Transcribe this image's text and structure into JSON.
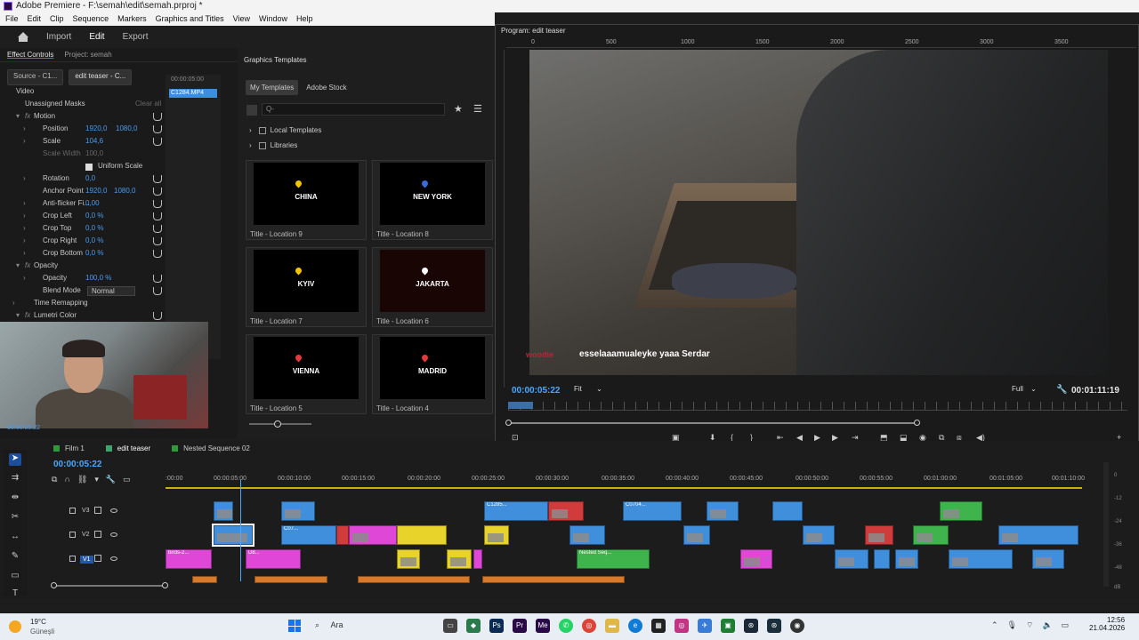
{
  "window": {
    "title": "Adobe Premiere - F:\\semah\\edit\\semah.prproj *"
  },
  "menu": [
    "File",
    "Edit",
    "Clip",
    "Sequence",
    "Markers",
    "Graphics and Titles",
    "View",
    "Window",
    "Help"
  ],
  "app_tabs": {
    "import": "Import",
    "edit": "Edit",
    "export": "Export"
  },
  "effect_controls": {
    "tab_label": "Effect Controls",
    "project_label": "Project: semah",
    "source_label": "Source - C1...",
    "sequence_label": "edit teaser - C...",
    "timecode": "00:00:05:00",
    "clip_name": "C1284.MP4",
    "section": "Video",
    "masks": "Unassigned Masks",
    "clear_all": "Clear all",
    "rows": [
      {
        "name": "Motion",
        "value": ""
      },
      {
        "name": "Position",
        "value": "1920,0",
        "value2": "1080,0"
      },
      {
        "name": "Scale",
        "value": "104,6"
      },
      {
        "name": "Scale Width",
        "value": "100,0"
      },
      {
        "name": "Uniform Scale",
        "value": ""
      },
      {
        "name": "Rotation",
        "value": "0,0"
      },
      {
        "name": "Anchor Point",
        "value": "1920,0",
        "value2": "1080,0"
      },
      {
        "name": "Anti-flicker Fi...",
        "value": "0,00"
      },
      {
        "name": "Crop Left",
        "value": "0,0 %"
      },
      {
        "name": "Crop Top",
        "value": "0,0 %"
      },
      {
        "name": "Crop Right",
        "value": "0,0 %"
      },
      {
        "name": "Crop Bottom",
        "value": "0,0 %"
      },
      {
        "name": "Opacity",
        "value": ""
      },
      {
        "name": "Opacity",
        "value": "100,0 %"
      },
      {
        "name": "Blend Mode",
        "value": "Normal"
      },
      {
        "name": "Time Remapping",
        "value": ""
      },
      {
        "name": "Lumetri Color",
        "value": ""
      }
    ],
    "bottom_timecode": "00:00:05:22"
  },
  "graphics_templates": {
    "title": "Graphics Templates",
    "tabs": [
      "My Templates",
      "Adobe Stock"
    ],
    "search_placeholder": "Q-",
    "folders": [
      "Local Templates",
      "Libraries"
    ],
    "templates": [
      {
        "thumb": "CHINA",
        "caption": "Title - Location 9",
        "pin": "yellow"
      },
      {
        "thumb": "NEW YORK",
        "caption": "Title - Location 8",
        "pin": "blue"
      },
      {
        "thumb": "KYIV",
        "caption": "Title - Location 7",
        "pin": "yellow"
      },
      {
        "thumb": "JAKARTA",
        "caption": "Title - Location 6",
        "pin": "white"
      },
      {
        "thumb": "VIENNA",
        "caption": "Title - Location 5",
        "pin": "red"
      },
      {
        "thumb": "MADRID",
        "caption": "Title - Location 4",
        "pin": "red"
      }
    ]
  },
  "program": {
    "title": "Program: edit teaser",
    "ruler": [
      "0",
      "500",
      "1000",
      "1500",
      "2000",
      "2500",
      "3000",
      "3500"
    ],
    "subtitle": "esselaaamualeyke yaaa Serdar",
    "watermark": "woodie",
    "timecode_left": "00:00:05:22",
    "fit": "Fit",
    "quality": "Full",
    "timecode_right": "00:01:11:19"
  },
  "timeline": {
    "tabs": [
      "Film 1",
      "edit teaser",
      "Nested Sequence 02"
    ],
    "timecode": "00:00:05:22",
    "ruler": [
      ":00:00",
      "00:00:05:00",
      "00:00:10:00",
      "00:00:15:00",
      "00:00:20:00",
      "00:00:25:00",
      "00:00:30:00",
      "00:00:35:00",
      "00:00:40:00",
      "00:00:45:00",
      "00:00:50:00",
      "00:00:55:00",
      "00:01:00:00",
      "00:01:05:00",
      "00:01:10:00"
    ],
    "tracks": [
      "V3",
      "V2",
      "V1"
    ],
    "clip_labels": {
      "c1285": "C1285...",
      "c0704": "C0704...",
      "c07": "C07...",
      "birds": "birds-2...",
      "d8": "D8...",
      "nested": "Nested Seq..."
    },
    "meter_labels": [
      "0",
      "-12",
      "-24",
      "-36",
      "-48",
      "dB"
    ]
  },
  "taskbar": {
    "temp": "19°C",
    "weather": "Güneşli",
    "search": "Ara",
    "time": "12:56",
    "date": "21.04.2026"
  },
  "colors": {
    "accent": "#2d7ff9",
    "clip_blue": "#3f8fdc",
    "clip_pink": "#df48d6",
    "clip_yellow": "#e8d32a",
    "clip_red": "#d03b3b",
    "clip_green": "#3fb34c",
    "audio": "#d87a2b"
  }
}
